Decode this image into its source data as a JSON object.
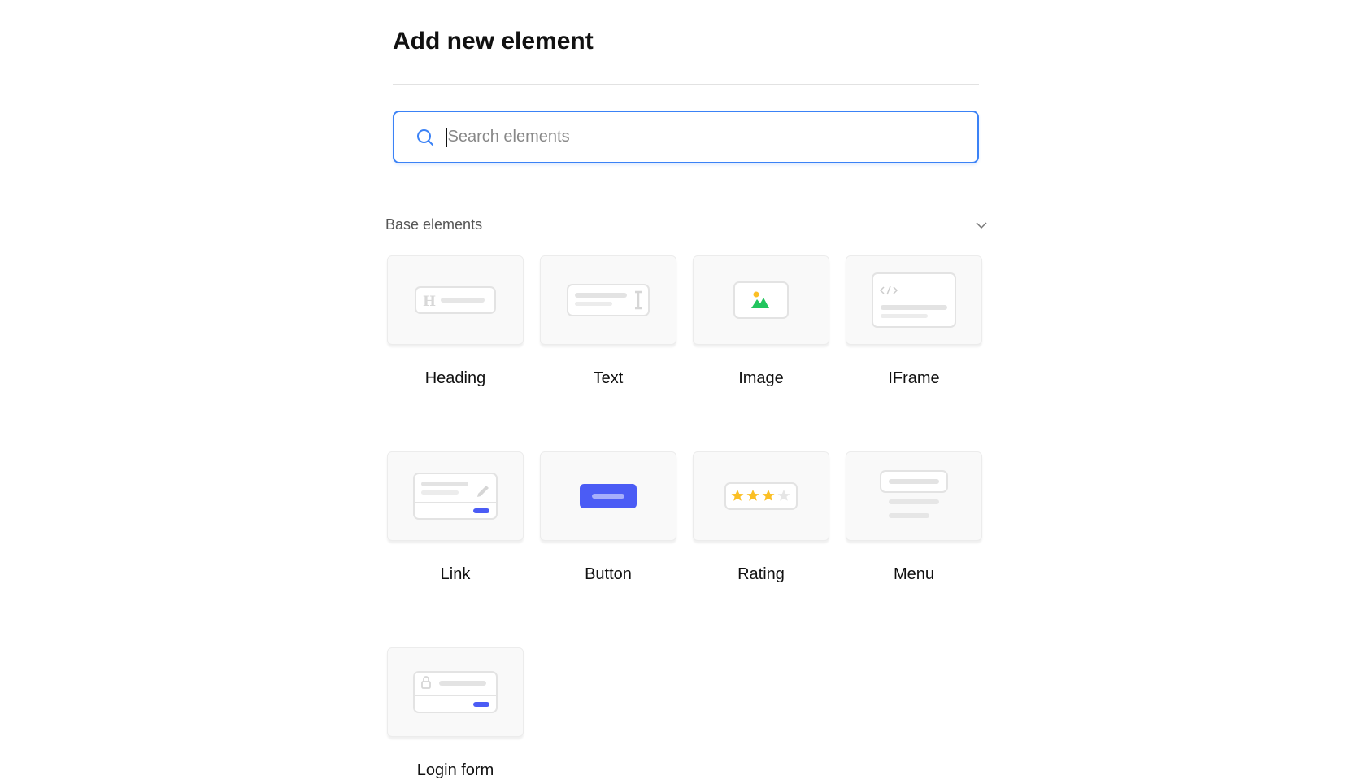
{
  "header": {
    "title": "Add new element"
  },
  "search": {
    "placeholder": "Search elements",
    "value": ""
  },
  "section": {
    "label": "Base elements",
    "expanded": true
  },
  "elements": [
    {
      "label": "Heading",
      "icon": "heading-icon"
    },
    {
      "label": "Text",
      "icon": "text-icon"
    },
    {
      "label": "Image",
      "icon": "image-icon"
    },
    {
      "label": "IFrame",
      "icon": "iframe-icon"
    },
    {
      "label": "Link",
      "icon": "link-icon"
    },
    {
      "label": "Button",
      "icon": "button-icon"
    },
    {
      "label": "Rating",
      "icon": "rating-icon"
    },
    {
      "label": "Menu",
      "icon": "menu-icon"
    },
    {
      "label": "Login form",
      "icon": "login-form-icon"
    }
  ],
  "colors": {
    "accent": "#3b82f6",
    "button": "#4b5cf5",
    "star": "#fbbf24",
    "image_green": "#22c55e"
  }
}
